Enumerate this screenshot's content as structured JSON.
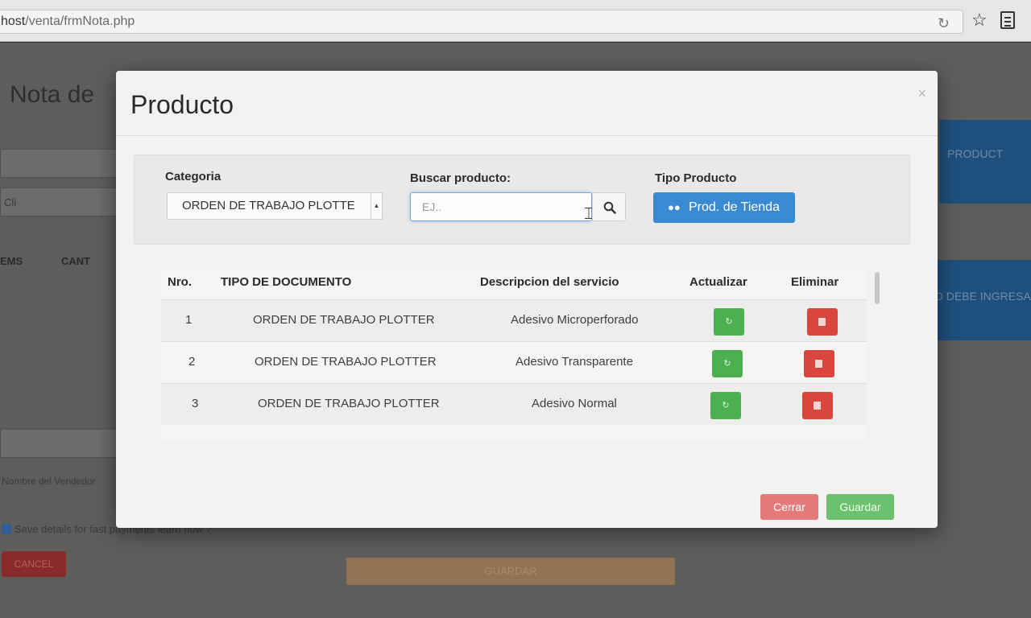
{
  "browser": {
    "url_prefix": "host",
    "url_path": "/venta/frmNota.php"
  },
  "background_page": {
    "title": "Nota de",
    "field_placeholder_cli": "Cli",
    "col_items": "EMS",
    "col_cant": "CANT",
    "vendedor_placeholder": "Nombre del Vendedor",
    "save_details": "Save details for fast payments",
    "save_details_link": "learn how ?",
    "cancel_label": "CANCEL",
    "guardar_label": "GUARDAR",
    "right_button_1": "PRODUCT",
    "right_button_2": "O DEBE INGRESA"
  },
  "modal": {
    "title": "Producto",
    "close_glyph": "×",
    "categoria_label": "Categoria",
    "categoria_value": "ORDEN DE TRABAJO PLOTTE",
    "buscar_label": "Buscar producto:",
    "buscar_placeholder": "EJ..",
    "tipo_label": "Tipo Producto",
    "tipo_button": "Prod. de Tienda",
    "table": {
      "headers": {
        "nro": "Nro.",
        "tipo": "TIPO DE DOCUMENTO",
        "descripcion": "Descripcion del servicio",
        "actualizar": "Actualizar",
        "eliminar": "Eliminar"
      },
      "rows": [
        {
          "nro": "1",
          "tipo": "ORDEN DE TRABAJO PLOTTER",
          "descripcion": "Adesivo Microperforado"
        },
        {
          "nro": "2",
          "tipo": "ORDEN DE TRABAJO PLOTTER",
          "descripcion": "Adesivo Transparente"
        },
        {
          "nro": "3",
          "tipo": "ORDEN DE TRABAJO PLOTTER",
          "descripcion": "Adesivo Normal"
        }
      ]
    },
    "footer": {
      "cerrar": "Cerrar",
      "guardar": "Guardar"
    }
  },
  "colors": {
    "primary": "#3a8ad3",
    "success": "#4caf50",
    "danger": "#d9463e"
  },
  "icons": {
    "search": "search-icon",
    "users": "users-icon",
    "refresh": "refresh-icon",
    "trash": "trash-icon",
    "star": "star-icon",
    "reload": "reload-icon"
  }
}
